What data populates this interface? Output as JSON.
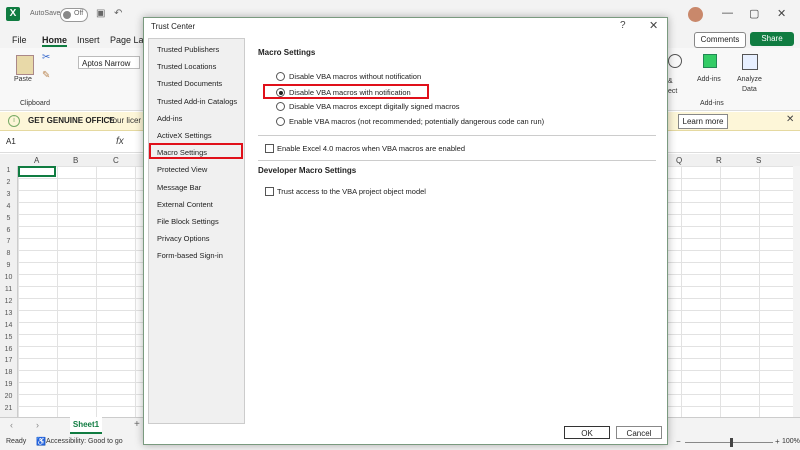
{
  "excel": {
    "autosave_label": "AutoSave",
    "autosave_state": "Off",
    "menu": [
      "File",
      "Home",
      "Insert",
      "Page La"
    ],
    "comments_label": "Comments",
    "share_label": "Share",
    "paste_label": "Paste",
    "clipboard_label": "Clipboard",
    "font_name": "Aptos Narrow",
    "ribbon_right": {
      "ampersand": "&",
      "select": "ect",
      "addins": "Add-ins",
      "addins_group": "Add-ins",
      "analyze": "Analyze",
      "data": "Data"
    },
    "message_title": "GET GENUINE OFFICE",
    "message_text": "Your licer",
    "learn_more": "Learn more",
    "name_box": "A1",
    "fx_label": "fx",
    "columns_left": [
      "A",
      "B",
      "C"
    ],
    "columns_right": [
      "Q",
      "R",
      "S"
    ],
    "rows": [
      "1",
      "2",
      "3",
      "4",
      "5",
      "6",
      "7",
      "8",
      "9",
      "10",
      "11",
      "12",
      "13",
      "14",
      "15",
      "16",
      "17",
      "18",
      "19",
      "20",
      "21"
    ],
    "sheet_tab": "Sheet1",
    "status_ready": "Ready",
    "status_accessibility": "Accessibility: Good to go",
    "zoom": "100%",
    "colors": {
      "excel_green": "#107c41",
      "highlight_red": "#e0101a"
    }
  },
  "dialog": {
    "title": "Trust Center",
    "help": "?",
    "close": "✕",
    "nav": [
      "Trusted Publishers",
      "Trusted Locations",
      "Trusted Documents",
      "Trusted Add-in Catalogs",
      "Add-ins",
      "ActiveX Settings",
      "Macro Settings",
      "Protected View",
      "Message Bar",
      "External Content",
      "File Block Settings",
      "Privacy Options",
      "Form-based Sign-in"
    ],
    "selected_nav": "Macro Settings",
    "macro_header": "Macro Settings",
    "macro_options": [
      "Disable VBA macros without notification",
      "Disable VBA macros with notification",
      "Disable VBA macros except digitally signed macros",
      "Enable VBA macros (not recommended; potentially dangerous code can run)"
    ],
    "selected_option": "Disable VBA macros with notification",
    "excel4_label": "Enable Excel 4.0 macros when VBA macros are enabled",
    "dev_header": "Developer Macro Settings",
    "vba_trust_label": "Trust access to the VBA project object model",
    "ok": "OK",
    "cancel": "Cancel"
  }
}
